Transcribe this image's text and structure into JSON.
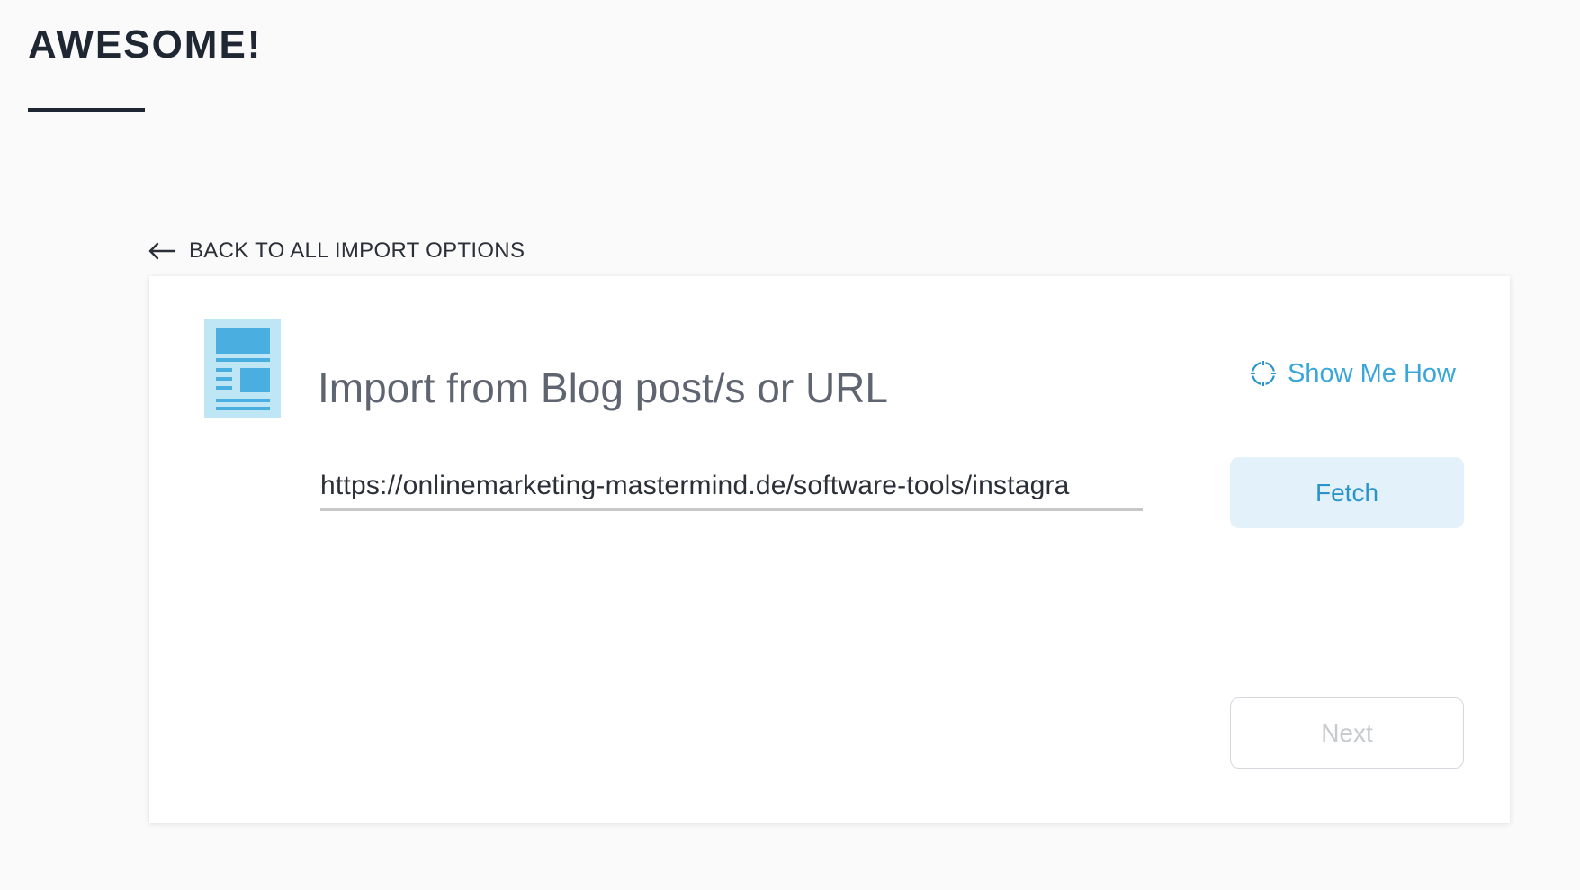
{
  "header": {
    "title": "AWESOME!"
  },
  "back_link": {
    "label": "BACK TO ALL IMPORT OPTIONS",
    "icon": "arrow-left-icon"
  },
  "card": {
    "icon": "document-icon",
    "title": "Import from Blog post/s or URL",
    "show_me_how": {
      "label": "Show Me How",
      "icon": "target-icon"
    },
    "url_input": {
      "value": "https://onlinemarketing-mastermind.de/software-tools/instagra"
    },
    "fetch_label": "Fetch",
    "next_label": "Next"
  },
  "colors": {
    "background": "#fafafa",
    "title": "#1f2733",
    "accent": "#3aa6da",
    "fetch_bg": "#e2f1fa",
    "icon_light": "#bfe6f4",
    "icon_dark": "#4aaee0",
    "disabled_text": "#c7cace"
  }
}
